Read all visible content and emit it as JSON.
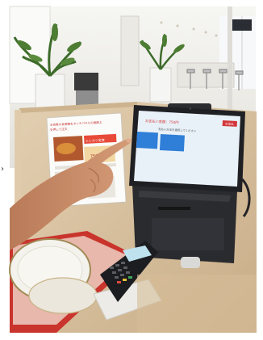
{
  "kiosk": {
    "screen_title": "お支払い金額：750円",
    "screen_instruction": "支払い方法を選択してください",
    "screen_corner_button": "お支払",
    "option_buttons": [
      "",
      ""
    ]
  },
  "poster": {
    "heading_line1": "お食事の食券機をタッチパネルの画面上",
    "heading_line2": "を押して注文",
    "photo_label": "ヒレカツ定食",
    "photo_price": "750円"
  },
  "colors": {
    "wall": "#f1f1ee",
    "counter_wood": "#d9c3a3",
    "screen": "#e8f1f7",
    "button_blue": "#2f7ed8",
    "accent_red": "#d2363a",
    "tray_red": "#c9342c",
    "plate": "#f4f2ec",
    "skin": "#c98e6a"
  }
}
